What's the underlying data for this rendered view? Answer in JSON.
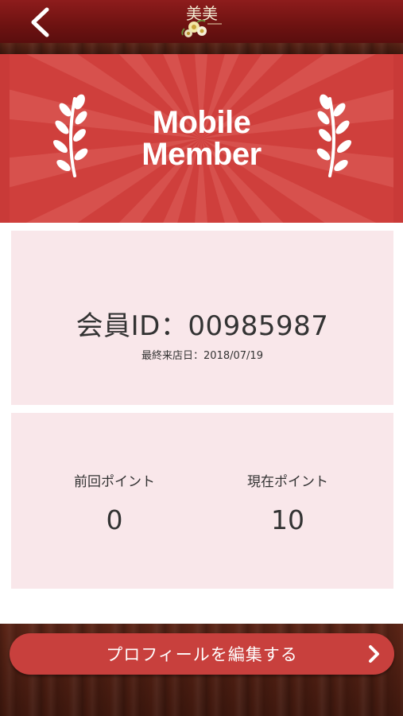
{
  "header": {
    "back_icon": "chevron-left-icon",
    "logo_text": "美美"
  },
  "banner": {
    "title_line1": "Mobile",
    "title_line2": "Member",
    "left_icon": "laurel-branch-icon",
    "right_icon": "laurel-branch-icon"
  },
  "member": {
    "id_label": "会員ID：00985987",
    "last_visit": "最終来店日：2018/07/19"
  },
  "points": {
    "previous_label": "前回ポイント",
    "previous_value": "0",
    "current_label": "現在ポイント",
    "current_value": "10"
  },
  "footer": {
    "edit_profile_label": "プロフィールを編集する",
    "edit_chevron_icon": "chevron-right-icon"
  },
  "colors": {
    "header": "#7a1514",
    "banner": "#cf3f3c",
    "card": "#f9e7ea",
    "button": "#c8403d"
  }
}
